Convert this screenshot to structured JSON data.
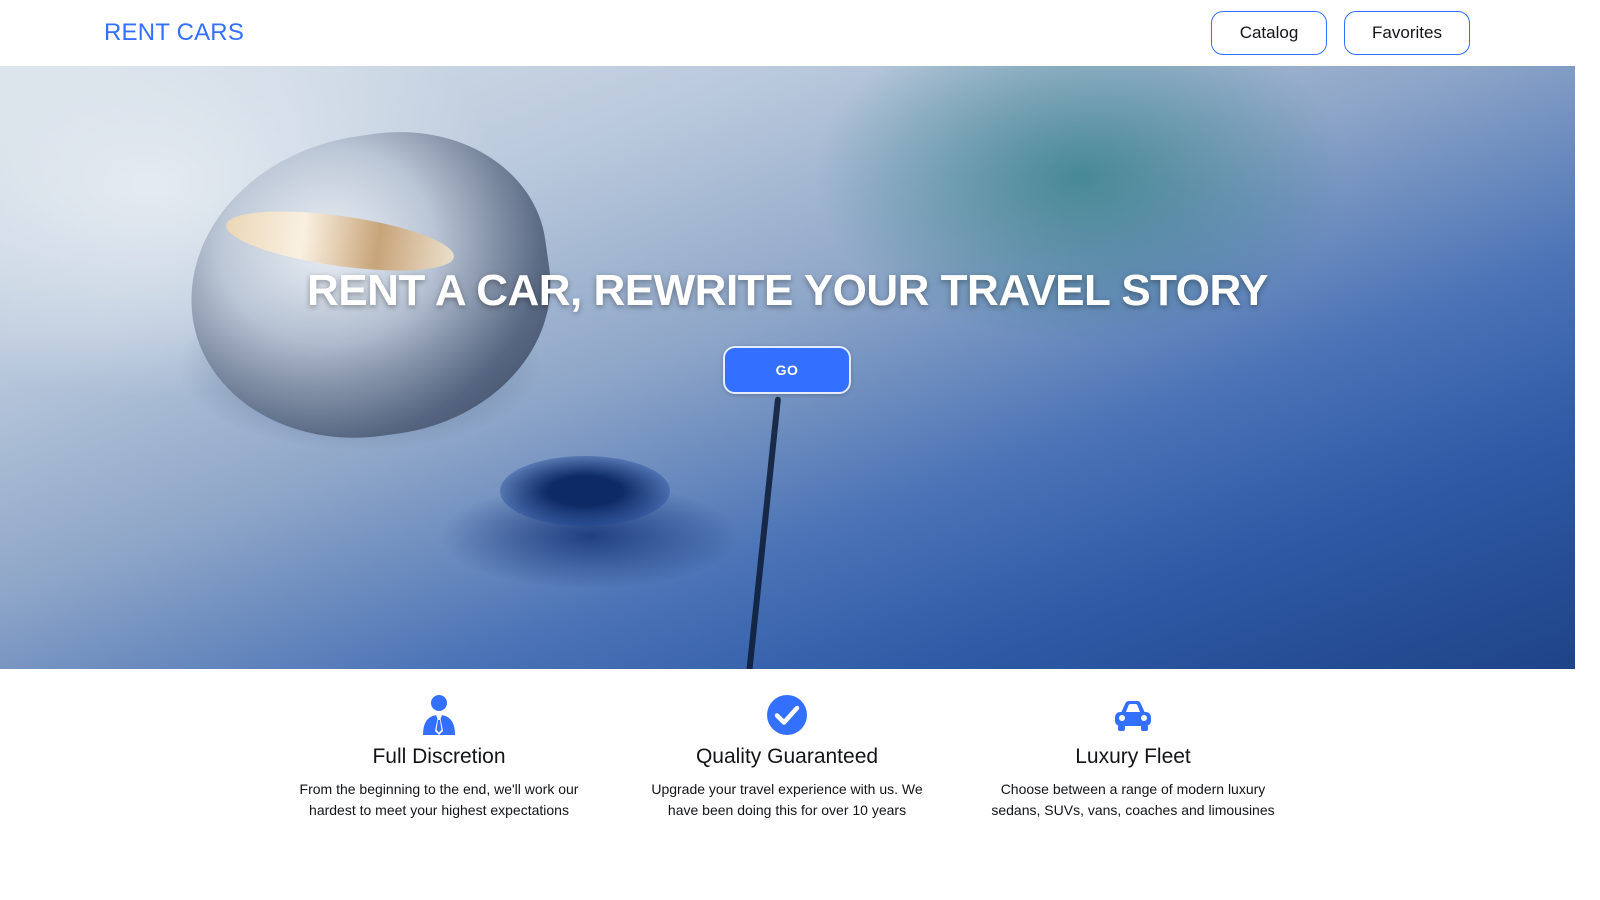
{
  "header": {
    "logo": "RENT CARS",
    "nav": {
      "catalog": "Catalog",
      "favorites": "Favorites"
    }
  },
  "hero": {
    "title": "RENT A CAR, REWRITE YOUR TRAVEL STORY",
    "go_button": "GO"
  },
  "features": [
    {
      "icon": "person-tie-icon",
      "title": "Full Discretion",
      "text": "From the beginning to the end, we'll work our hardest to meet your highest expectations"
    },
    {
      "icon": "check-circle-icon",
      "title": "Quality Guaranteed",
      "text": "Upgrade your travel experience with us. We have been doing this for over 10 years"
    },
    {
      "icon": "car-icon",
      "title": "Luxury Fleet",
      "text": "Choose between a range of modern luxury sedans, SUVs, vans, coaches and limousines"
    }
  ],
  "colors": {
    "accent": "#3470ff",
    "text": "#121417",
    "background": "#ffffff"
  }
}
